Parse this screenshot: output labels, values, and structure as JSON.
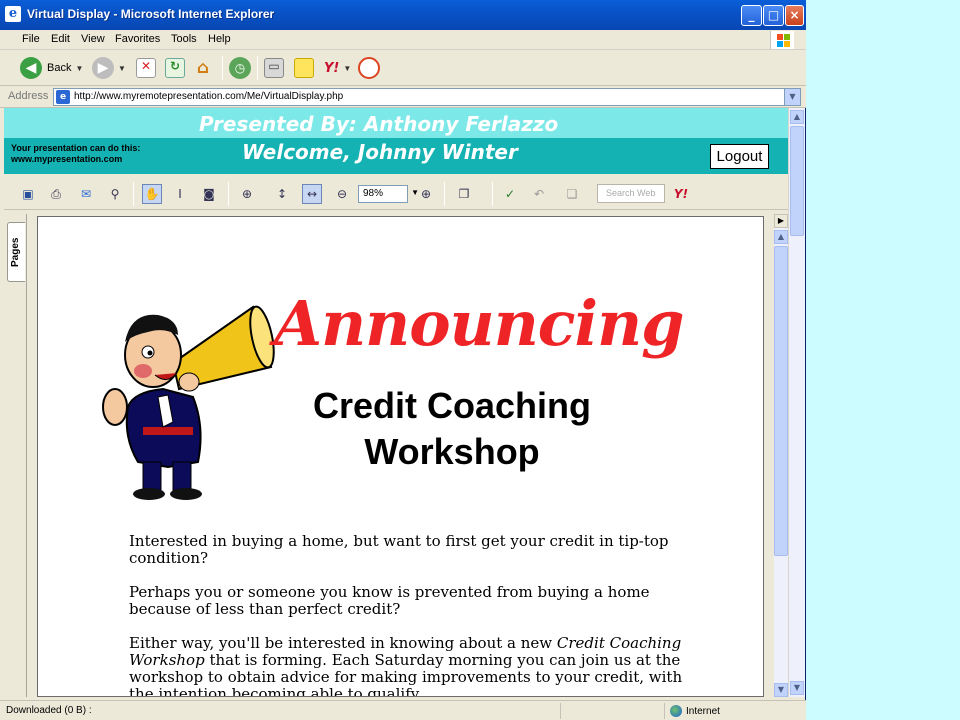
{
  "window": {
    "title": "Virtual Display - Microsoft Internet Explorer",
    "minimize": "_",
    "maximize": "□",
    "close": "×"
  },
  "menu": [
    "File",
    "Edit",
    "View",
    "Favorites",
    "Tools",
    "Help"
  ],
  "toolbar": {
    "back_label": "Back"
  },
  "address": {
    "label": "Address",
    "url": "http://www.myremotepresentation.com/Me/VirtualDisplay.php"
  },
  "banner": {
    "presented_by": "Presented By: Anthony Ferlazzo",
    "welcome": "Welcome, Johnny Winter",
    "note_line1": "Your presentation can do this:",
    "note_line2": "www.mypresentation.com",
    "logout_label": "Logout",
    "top_color": "#7de8e8",
    "bottom_color": "#14b2b2"
  },
  "pdf_toolbar": {
    "zoom_value": "98%",
    "search_placeholder": "Search Web"
  },
  "sidebar": {
    "pages_tab": "Pages"
  },
  "document": {
    "headline": "Announcing",
    "title_line1": "Credit Coaching",
    "title_line2": "Workshop",
    "para1": "Interested in buying a home, but want to first get your credit in tip-top condition?",
    "para2": "Perhaps you or someone you know is prevented from buying a home because of less than perfect credit?",
    "para3_start": "Either way, you'll be interested in knowing about a new ",
    "para3_em": "Credit Coaching Workshop",
    "para3_end": " that is forming. Each Saturday morning you can join us at the workshop to obtain advice for making improvements to your credit, with the intention becoming able to qualify"
  },
  "status": {
    "text": "Downloaded  (0 B) :",
    "zone": "Internet"
  },
  "colors": {
    "headline": "#ee2426",
    "xp_blue": "#0953c7"
  }
}
